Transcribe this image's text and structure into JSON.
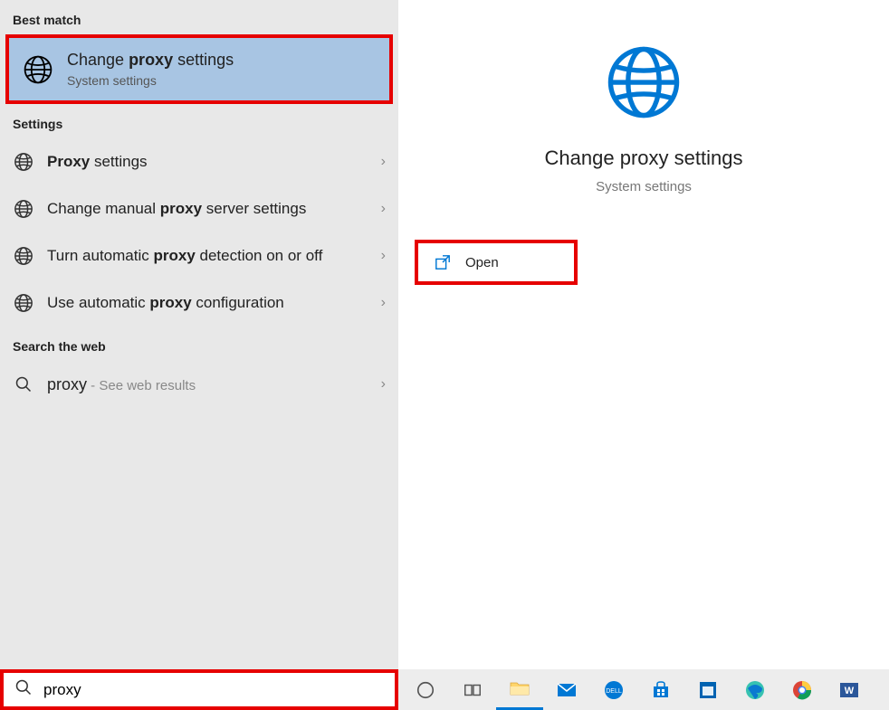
{
  "left": {
    "best_match_header": "Best match",
    "best_match": {
      "title_pre": "Change ",
      "title_bold": "proxy",
      "title_post": " settings",
      "subtitle": "System settings"
    },
    "settings_header": "Settings",
    "settings": [
      {
        "pre": "",
        "bold": "Proxy",
        "post": " settings"
      },
      {
        "pre": "Change manual ",
        "bold": "proxy",
        "post": " server settings"
      },
      {
        "pre": "Turn automatic ",
        "bold": "proxy",
        "post": " detection on or off"
      },
      {
        "pre": "Use automatic ",
        "bold": "proxy",
        "post": " configuration"
      }
    ],
    "search_web_header": "Search the web",
    "web": {
      "term": "proxy",
      "hint": " - See web results"
    }
  },
  "right": {
    "title": "Change proxy settings",
    "subtitle": "System settings",
    "open_label": "Open"
  },
  "search": {
    "value": "proxy"
  },
  "taskbar": {
    "icons": [
      "cortana-icon",
      "task-view-icon",
      "file-explorer-icon",
      "mail-icon",
      "dell-icon",
      "store-icon",
      "company-portal-icon",
      "edge-icon",
      "chrome-icon",
      "word-icon"
    ]
  },
  "colors": {
    "accent": "#0078d4",
    "highlight_border": "#e60000",
    "selected_bg": "#a8c5e3"
  }
}
